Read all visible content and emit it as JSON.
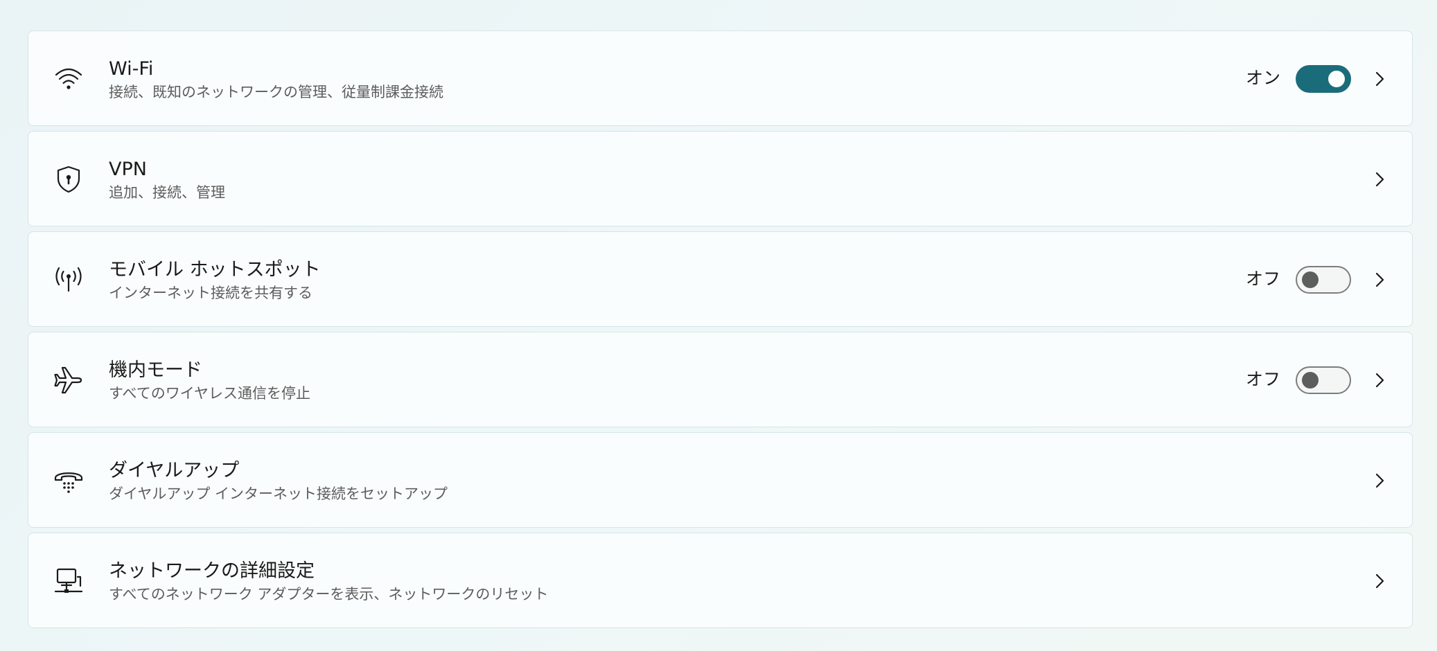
{
  "items": [
    {
      "title": "Wi-Fi",
      "subtitle": "接続、既知のネットワークの管理、従量制課金接続",
      "icon": "wifi-icon",
      "state_label": "オン",
      "toggle": "on"
    },
    {
      "title": "VPN",
      "subtitle": "追加、接続、管理",
      "icon": "shield-icon"
    },
    {
      "title": "モバイル ホットスポット",
      "subtitle": "インターネット接続を共有する",
      "icon": "hotspot-icon",
      "state_label": "オフ",
      "toggle": "off"
    },
    {
      "title": "機内モード",
      "subtitle": "すべてのワイヤレス通信を停止",
      "icon": "airplane-icon",
      "state_label": "オフ",
      "toggle": "off"
    },
    {
      "title": "ダイヤルアップ",
      "subtitle": "ダイヤルアップ インターネット接続をセットアップ",
      "icon": "dialup-phone-icon"
    },
    {
      "title": "ネットワークの詳細設定",
      "subtitle": "すべてのネットワーク アダプターを表示、ネットワークのリセット",
      "icon": "network-adapter-icon"
    }
  ],
  "colors": {
    "accent": "#1b6c7a",
    "toggle_off_knob": "#5d5d5d",
    "card_border": "#d6e4e6"
  }
}
